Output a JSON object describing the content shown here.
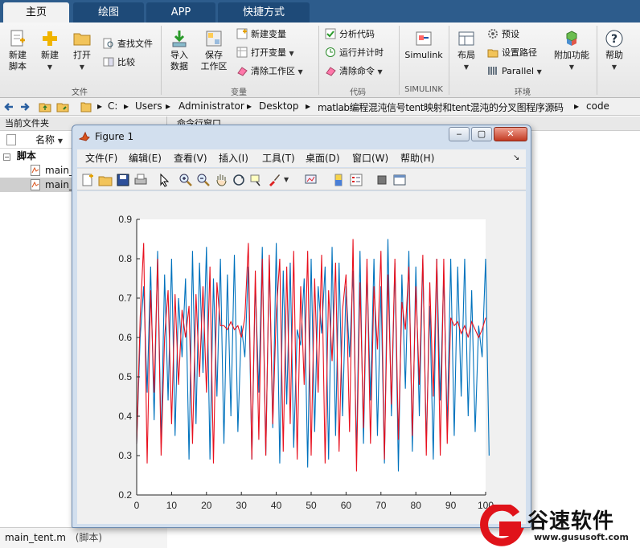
{
  "ribbon_tabs": [
    "主页",
    "绘图",
    "APP",
    "快捷方式"
  ],
  "ribbon": {
    "file_group": {
      "label": "文件",
      "new_script": "新建\n脚本",
      "new": "新建",
      "open": "打开",
      "find_files": "查找文件",
      "compare": "比较"
    },
    "variable_group": {
      "label": "变量",
      "import": "导入\n数据",
      "save_ws": "保存\n工作区",
      "new_var": "新建变量",
      "open_var": "打开变量",
      "clear_ws": "清除工作区"
    },
    "code_group": {
      "label": "代码",
      "analyze": "分析代码",
      "run_time": "运行并计时",
      "clear_cmd": "清除命令"
    },
    "simulink_group": {
      "label": "SIMULINK",
      "simulink": "Simulink"
    },
    "env_group": {
      "label": "环境",
      "layout": "布局",
      "prefs": "预设",
      "set_path": "设置路径",
      "parallel": "Parallel",
      "addons": "附加功能"
    },
    "help": "帮助"
  },
  "path": [
    "C:",
    "Users",
    "Administrator",
    "Desktop",
    "matlab编程混沌信号tent映射和tent混沌的分叉图程序源码",
    "code"
  ],
  "left_panel": {
    "title": "当前文件夹",
    "name_header": "名称",
    "tree_root": "脚本",
    "files": [
      "main_",
      "main_"
    ],
    "footer": "main_tent.m",
    "footer_type": "(脚本)"
  },
  "command_window_title": "命令行窗口",
  "figure": {
    "title": "Figure 1",
    "menu": [
      "文件(F)",
      "编辑(E)",
      "查看(V)",
      "插入(I)",
      "工具(T)",
      "桌面(D)",
      "窗口(W)",
      "帮助(H)"
    ]
  },
  "colors": {
    "series_blue": "#0072bd",
    "series_red": "#e8101e",
    "ribbon_blue": "#2d5c8c"
  },
  "chart_data": {
    "type": "line",
    "xlim": [
      0,
      100
    ],
    "ylim": [
      0.2,
      0.9
    ],
    "xticks": [
      0,
      10,
      20,
      30,
      40,
      50,
      60,
      70,
      80,
      90,
      100
    ],
    "yticks": [
      0.2,
      0.3,
      0.4,
      0.5,
      0.6,
      0.7,
      0.8,
      0.9
    ],
    "grid": false,
    "series": [
      {
        "color": "#0072bd",
        "values": [
          0.33,
          0.6,
          0.73,
          0.46,
          0.78,
          0.39,
          0.82,
          0.33,
          0.76,
          0.44,
          0.8,
          0.35,
          0.7,
          0.55,
          0.75,
          0.29,
          0.82,
          0.38,
          0.79,
          0.51,
          0.83,
          0.29,
          0.75,
          0.45,
          0.8,
          0.33,
          0.76,
          0.4,
          0.81,
          0.36,
          0.63,
          0.55,
          0.78,
          0.29,
          0.74,
          0.46,
          0.83,
          0.3,
          0.8,
          0.37,
          0.84,
          0.28,
          0.77,
          0.43,
          0.79,
          0.32,
          0.62,
          0.58,
          0.75,
          0.27,
          0.8,
          0.36,
          0.73,
          0.61,
          0.78,
          0.29,
          0.83,
          0.35,
          0.79,
          0.4,
          0.73,
          0.55,
          0.77,
          0.3,
          0.82,
          0.33,
          0.78,
          0.44,
          0.8,
          0.35,
          0.73,
          0.28,
          0.85,
          0.4,
          0.79,
          0.26,
          0.76,
          0.47,
          0.82,
          0.31,
          0.78,
          0.4,
          0.8,
          0.33,
          0.68,
          0.29,
          0.8,
          0.44,
          0.76,
          0.37,
          0.8,
          0.35,
          0.78,
          0.45,
          0.8,
          0.4,
          0.72,
          0.36,
          0.63,
          0.55,
          0.8,
          0.3
        ]
      },
      {
        "color": "#e8101e",
        "values": [
          0.33,
          0.65,
          0.84,
          0.28,
          0.72,
          0.46,
          0.8,
          0.3,
          0.6,
          0.72,
          0.38,
          0.71,
          0.48,
          0.67,
          0.6,
          0.68,
          0.33,
          0.71,
          0.5,
          0.73,
          0.46,
          0.78,
          0.28,
          0.74,
          0.63,
          0.63,
          0.62,
          0.64,
          0.62,
          0.63,
          0.6,
          0.65,
          0.84,
          0.29,
          0.77,
          0.34,
          0.8,
          0.3,
          0.81,
          0.38,
          0.66,
          0.8,
          0.31,
          0.78,
          0.38,
          0.82,
          0.29,
          0.73,
          0.48,
          0.82,
          0.3,
          0.75,
          0.46,
          0.81,
          0.28,
          0.72,
          0.54,
          0.79,
          0.31,
          0.67,
          0.76,
          0.36,
          0.85,
          0.26,
          0.74,
          0.37,
          0.8,
          0.33,
          0.73,
          0.57,
          0.82,
          0.29,
          0.76,
          0.43,
          0.8,
          0.34,
          0.69,
          0.62,
          0.78,
          0.35,
          0.73,
          0.48,
          0.81,
          0.3,
          0.74,
          0.45,
          0.8,
          0.3,
          0.8,
          0.33,
          0.65,
          0.63,
          0.64,
          0.61,
          0.63,
          0.6,
          0.64,
          0.62,
          0.6,
          0.62,
          0.65
        ]
      }
    ]
  },
  "logo": {
    "name": "谷速软件",
    "url": "www.gususoft.com"
  }
}
